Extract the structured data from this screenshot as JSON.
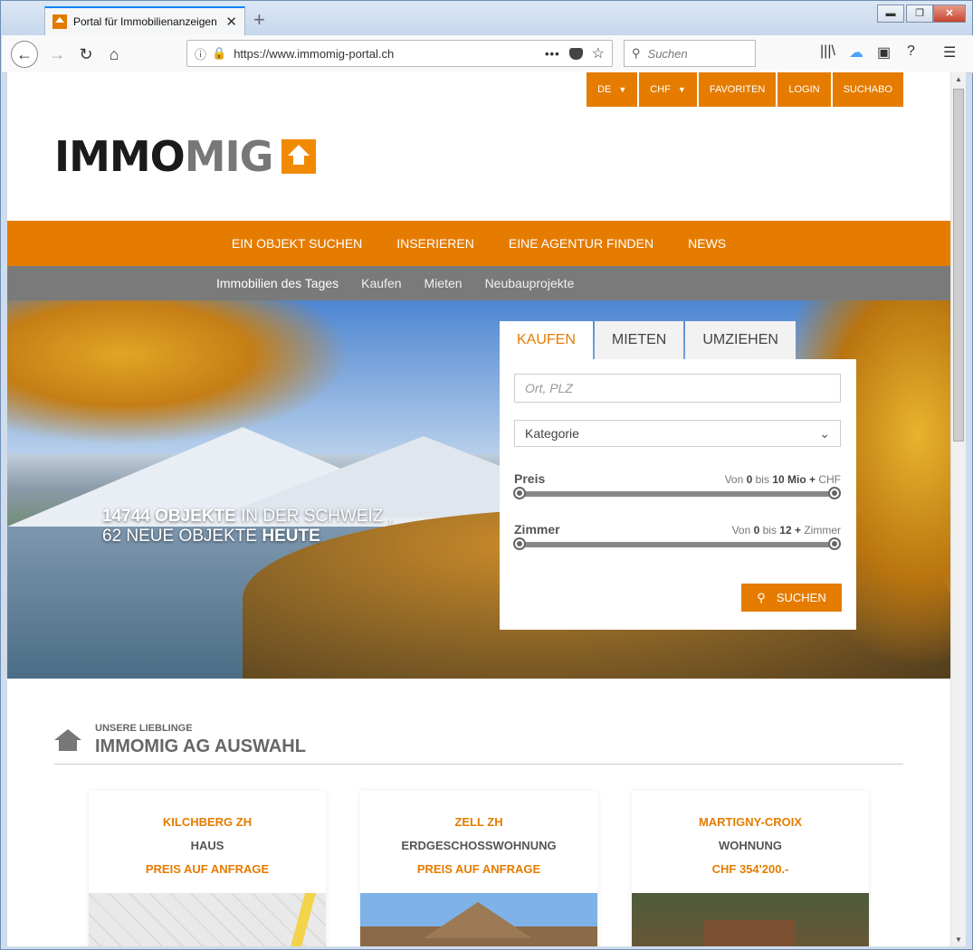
{
  "browser": {
    "tab_title": "Portal für Immobilienanzeigen",
    "tab_close": "✕",
    "new_tab": "+",
    "url": "https://www.immomig-portal.ch",
    "search_placeholder": "Suchen",
    "win_min": "▬",
    "win_max": "❐",
    "win_close": "✕"
  },
  "topmenu": {
    "lang": "DE",
    "currency": "CHF",
    "favorites": "FAVORITEN",
    "login": "LOGIN",
    "suchabo": "SUCHABO"
  },
  "logo": {
    "part1": "IMMO",
    "part2": "MIG"
  },
  "mainnav": [
    "EIN OBJEKT SUCHEN",
    "INSERIEREN",
    "EINE AGENTUR FINDEN",
    "NEWS"
  ],
  "subnav": [
    "Immobilien des Tages",
    "Kaufen",
    "Mieten",
    "Neubauprojekte"
  ],
  "hero": {
    "count": "14744 OBJEKTE",
    "count_suffix": " IN DER SCHWEIZ ,",
    "new_prefix": "62 NEUE OBJEKTE ",
    "new_suffix": "HEUTE"
  },
  "search": {
    "tabs": [
      "KAUFEN",
      "MIETEN",
      "UMZIEHEN"
    ],
    "location_placeholder": "Ort, PLZ",
    "category": "Kategorie",
    "price_label": "Preis",
    "price_from_word": "Von ",
    "price_from": "0",
    "price_to_word": " bis ",
    "price_to": "10 Mio +",
    "price_unit": " CHF",
    "rooms_label": "Zimmer",
    "rooms_from_word": "Von ",
    "rooms_from": "0",
    "rooms_to_word": " bis ",
    "rooms_to": "12 +",
    "rooms_unit": " Zimmer",
    "button": "SUCHEN"
  },
  "section": {
    "small": "UNSERE LIEBLINGE",
    "title": "IMMOMIG AG AUSWAHL"
  },
  "cards": [
    {
      "location": "KILCHBERG ZH",
      "type": "HAUS",
      "price": "PREIS AUF ANFRAGE"
    },
    {
      "location": "ZELL ZH",
      "type": "ERDGESCHOSSWOHNUNG",
      "price": "PREIS AUF ANFRAGE"
    },
    {
      "location": "MARTIGNY-CROIX",
      "type": "WOHNUNG",
      "price": "CHF 354'200.-"
    }
  ]
}
